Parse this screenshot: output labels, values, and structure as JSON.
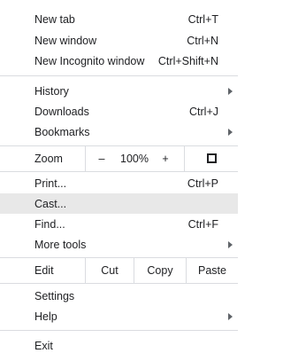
{
  "menu": {
    "new_tab": {
      "label": "New tab",
      "shortcut": "Ctrl+T"
    },
    "new_window": {
      "label": "New window",
      "shortcut": "Ctrl+N"
    },
    "new_incognito": {
      "label": "New Incognito window",
      "shortcut": "Ctrl+Shift+N"
    },
    "history": {
      "label": "History"
    },
    "downloads": {
      "label": "Downloads",
      "shortcut": "Ctrl+J"
    },
    "bookmarks": {
      "label": "Bookmarks"
    },
    "zoom": {
      "label": "Zoom",
      "minus": "–",
      "level": "100%",
      "plus": "+",
      "fullscreen_icon": "fullscreen-icon"
    },
    "print": {
      "label": "Print...",
      "shortcut": "Ctrl+P"
    },
    "cast": {
      "label": "Cast..."
    },
    "find": {
      "label": "Find...",
      "shortcut": "Ctrl+F"
    },
    "more_tools": {
      "label": "More tools"
    },
    "edit": {
      "label": "Edit",
      "cut": "Cut",
      "copy": "Copy",
      "paste": "Paste"
    },
    "settings": {
      "label": "Settings"
    },
    "help": {
      "label": "Help"
    },
    "exit": {
      "label": "Exit"
    }
  },
  "colors": {
    "highlight": "#e8e8e8",
    "separator": "#dadce0",
    "text": "#202124"
  }
}
